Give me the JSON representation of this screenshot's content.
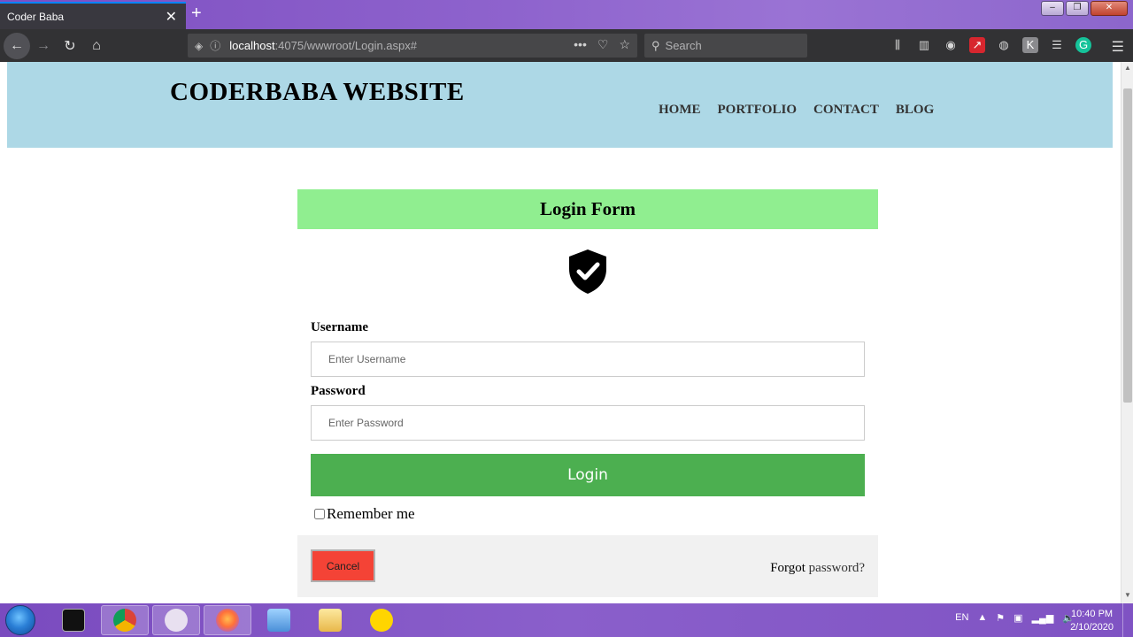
{
  "browser": {
    "tab_title": "Coder Baba",
    "url_host": "localhost",
    "url_rest": ":4075/wwwroot/Login.aspx#",
    "search_placeholder": "Search",
    "url_actions": [
      "•••"
    ]
  },
  "site": {
    "title": "CODERBABA WEBSITE",
    "nav": [
      "HOME",
      "PORTFOLIO",
      "CONTACT",
      "BLOG"
    ]
  },
  "login": {
    "heading": "Login Form",
    "username_label": "Username",
    "username_placeholder": "Enter Username",
    "password_label": "Password",
    "password_placeholder": "Enter Password",
    "login_button": "Login",
    "remember_label": "Remember me",
    "cancel_button": "Cancel",
    "forgot_prefix": "Forgot ",
    "forgot_link": "password?"
  },
  "taskbar": {
    "lang": "EN",
    "time": "10:40 PM",
    "date": "2/10/2020"
  },
  "colors": {
    "header_bg": "#add8e6",
    "form_heading_bg": "#90ee90",
    "login_button": "#4caf50",
    "cancel_button": "#f44336"
  }
}
